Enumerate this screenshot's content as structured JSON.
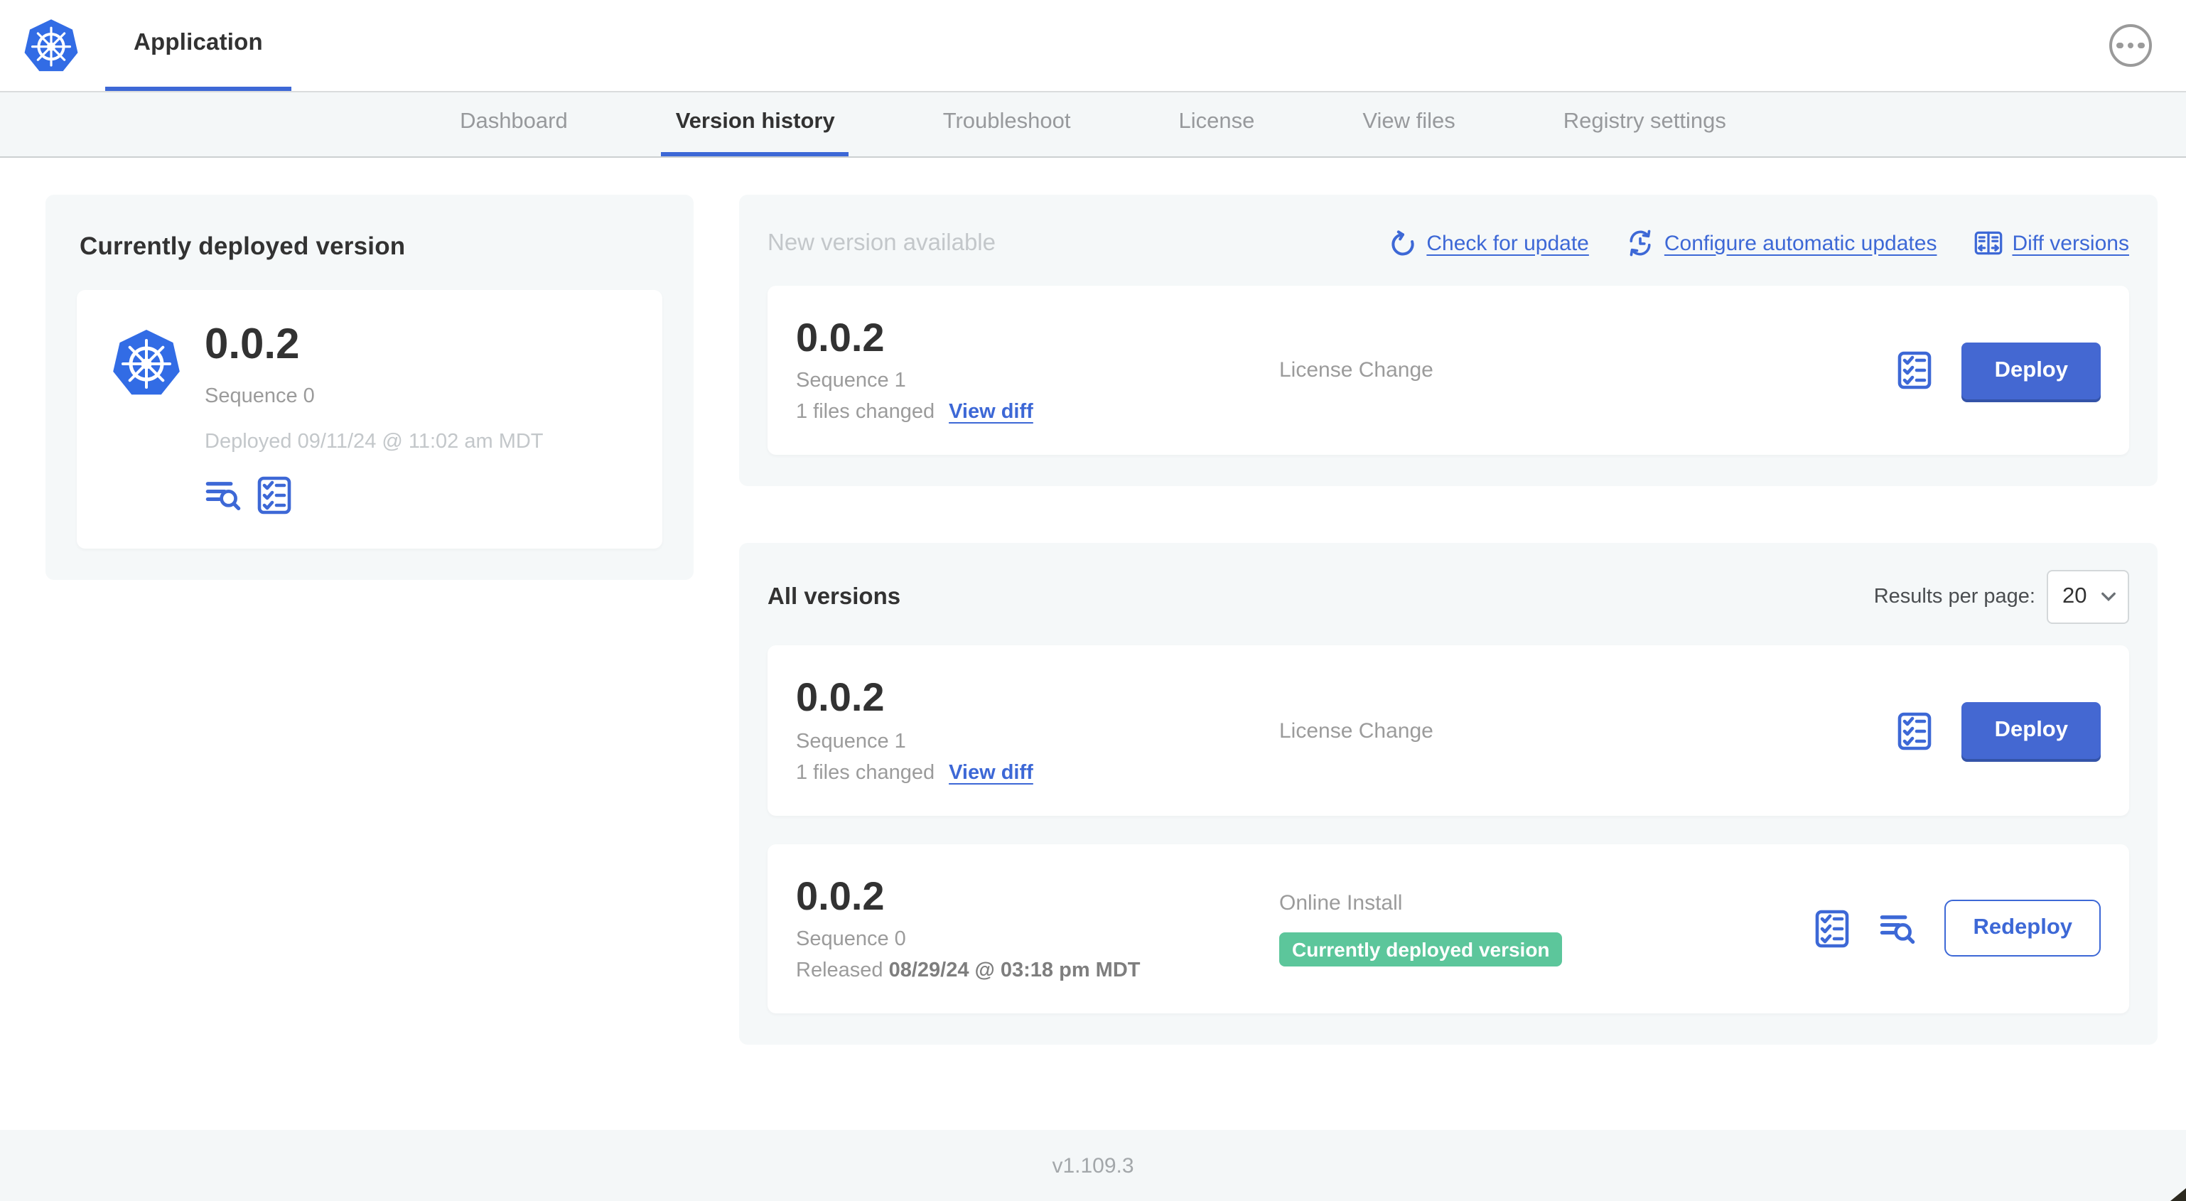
{
  "colors": {
    "accent_blue": "#3D68D6",
    "button_blue": "#4468D2",
    "kubernetes_blue": "#326CE5",
    "badge_green": "#5CC69B",
    "text_dark": "#323232",
    "text_gray": "#9B9B9B",
    "text_muted": "#C3C7CA",
    "panel_bg": "#F5F8F9"
  },
  "icons": {
    "logo": "kubernetes-wheel",
    "menu": "ellipsis-circle",
    "check_update": "restart-arrow",
    "auto_updates": "clock-refresh",
    "diff": "split-diff",
    "preflight": "checklist",
    "logs": "log-search",
    "select": "chevron-down"
  },
  "header": {
    "app_title": "Application"
  },
  "nav": {
    "tabs": [
      {
        "label": "Dashboard"
      },
      {
        "label": "Version history"
      },
      {
        "label": "Troubleshoot"
      },
      {
        "label": "License"
      },
      {
        "label": "View files"
      },
      {
        "label": "Registry settings"
      }
    ]
  },
  "deployed_panel": {
    "title": "Currently deployed version",
    "version": "0.0.2",
    "sequence": "Sequence 0",
    "deployed_at": "Deployed 09/11/24 @ 11:02 am MDT"
  },
  "new_version_panel": {
    "title": "New version available",
    "actions": {
      "check_for_update": "Check for update",
      "configure_automatic_updates": "Configure automatic updates",
      "diff_versions": "Diff versions"
    },
    "row": {
      "version": "0.0.2",
      "sequence": "Sequence 1",
      "files_changed": "1 files changed",
      "view_diff": "View diff",
      "source": "License Change",
      "deploy_label": "Deploy"
    }
  },
  "all_versions_panel": {
    "title": "All versions",
    "results_per_page_label": "Results per page:",
    "results_per_page_value": "20",
    "rows": [
      {
        "version": "0.0.2",
        "sequence": "Sequence 1",
        "files_changed": "1 files changed",
        "view_diff": "View diff",
        "source": "License Change",
        "deploy_label": "Deploy"
      },
      {
        "version": "0.0.2",
        "sequence": "Sequence 0",
        "released_prefix": "Released",
        "released_date": "08/29/24 @ 03:18 pm MDT",
        "source": "Online Install",
        "status_badge": "Currently deployed version",
        "redeploy_label": "Redeploy"
      }
    ]
  },
  "footer": {
    "app_manager_version": "v1.109.3"
  }
}
